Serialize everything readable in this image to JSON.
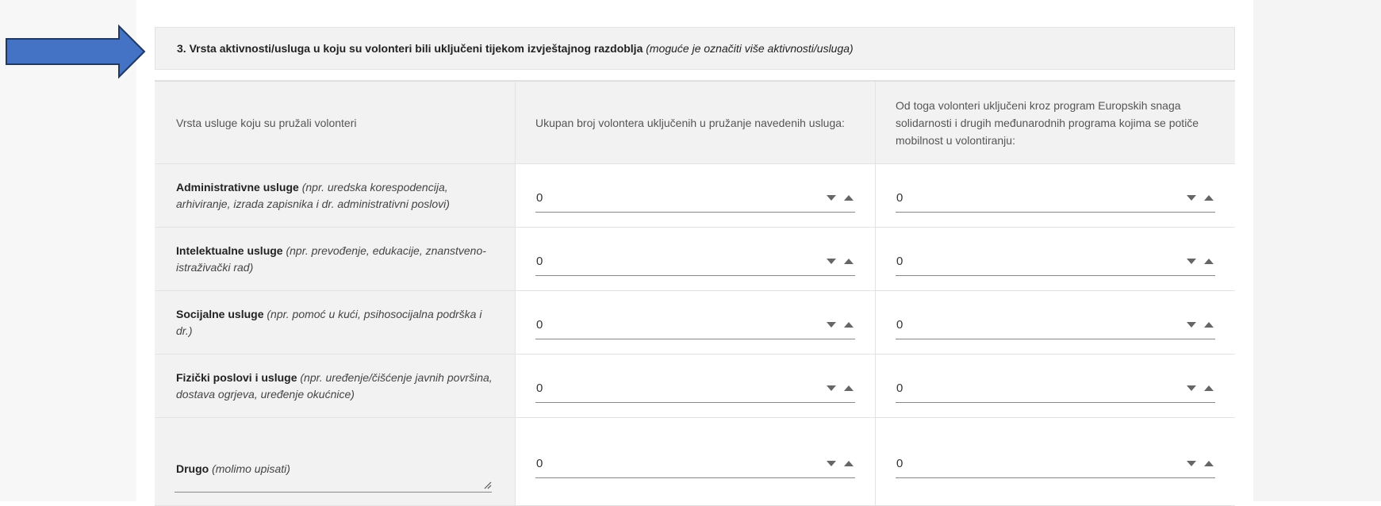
{
  "section": {
    "title": "3. Vrsta aktivnosti/usluga u koju su volonteri bili uključeni tijekom izvještajnog razdoblja",
    "hint": "(moguće je označiti više aktivnosti/usluga)"
  },
  "table": {
    "headers": [
      "Vrsta usluge koju su pružali volonteri",
      "Ukupan broj volontera uključenih u pružanje navedenih usluga:",
      "Od toga volonteri uključeni kroz program Europskih snaga solidarnosti i drugih međunarodnih programa kojima se potiče mobilnost u volontiranju:"
    ],
    "rows": [
      {
        "title": "Administrativne usluge",
        "desc": "(npr. uredska korespodencija, arhiviranje, izrada zapisnika i dr. administrativni poslovi)",
        "total": "0",
        "esc": "0"
      },
      {
        "title": "Intelektualne usluge",
        "desc": "(npr. prevođenje, edukacije, znanstveno-istraživački rad)",
        "total": "0",
        "esc": "0"
      },
      {
        "title": "Socijalne usluge",
        "desc": "(npr. pomoć u kući, psihosocijalna podrška i dr.)",
        "total": "0",
        "esc": "0"
      },
      {
        "title": "Fizički poslovi i usluge",
        "desc": "(npr. uređenje/čišćenje javnih površina, dostava ogrjeva, uređenje okućnice)",
        "total": "0",
        "esc": "0"
      },
      {
        "title": "Drugo",
        "desc": "(molimo upisati)",
        "total": "0",
        "esc": "0"
      }
    ]
  },
  "colors": {
    "arrow_fill": "#4472c4",
    "arrow_stroke": "#1f3864"
  }
}
